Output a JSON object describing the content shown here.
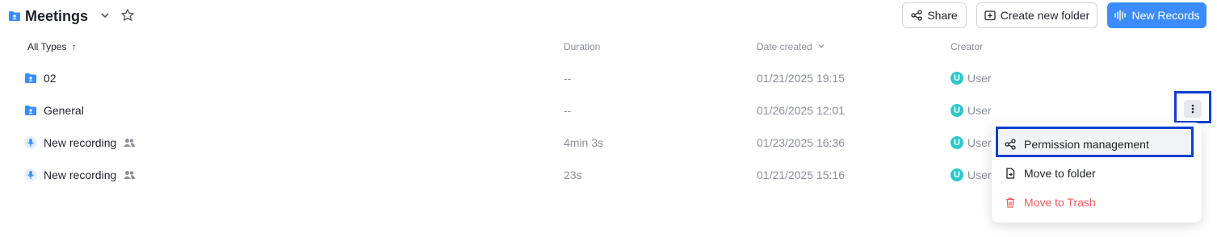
{
  "header": {
    "title": "Meetings",
    "share_label": "Share",
    "create_folder_label": "Create new folder",
    "new_records_label": "New Records"
  },
  "columns": {
    "type": "All Types",
    "duration": "Duration",
    "date": "Date created",
    "creator": "Creator"
  },
  "rows": [
    {
      "name": "02",
      "duration": "--",
      "date": "01/21/2025 19:15",
      "creator": "User",
      "kind": "folder"
    },
    {
      "name": "General",
      "duration": "--",
      "date": "01/26/2025 12:01",
      "creator": "User",
      "kind": "folder"
    },
    {
      "name": "New recording",
      "duration": "4min 3s",
      "date": "01/23/2025 16:36",
      "creator": "User",
      "kind": "recording"
    },
    {
      "name": "New recording",
      "duration": "23s",
      "date": "01/21/2025 15:16",
      "creator": "User",
      "kind": "recording"
    }
  ],
  "avatar_initial": "U",
  "context_menu": {
    "permission": "Permission management",
    "move": "Move to folder",
    "trash": "Move to Trash"
  },
  "colors": {
    "accent": "#3c8cff",
    "danger": "#f25c5c",
    "highlight": "#0a3fd1",
    "avatar": "#2ec7c9"
  }
}
